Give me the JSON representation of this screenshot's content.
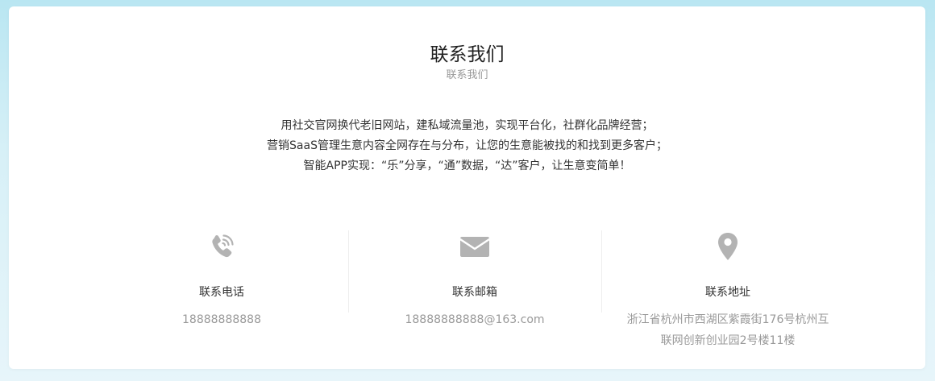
{
  "section": {
    "title": "联系我们",
    "subtitle": "联系我们"
  },
  "intro": {
    "lines": [
      "用社交官网换代老旧网站，建私域流量池，实现平台化，社群化品牌经营；",
      "营销SaaS管理生意内容全网存在与分布，让您的生意能被找的和找到更多客户；",
      "智能APP实现：“乐”分享，“通”数据，“达”客户，让生意变简单！"
    ]
  },
  "contacts": [
    {
      "icon": "phone-icon",
      "label": "联系电话",
      "value": "18888888888"
    },
    {
      "icon": "mail-icon",
      "label": "联系邮箱",
      "value": "18888888888@163.com"
    },
    {
      "icon": "location-pin-icon",
      "label": "联系地址",
      "value": "浙江省杭州市西湖区紫霞街176号杭州互联网创新创业园2号楼11楼"
    }
  ],
  "colors": {
    "icon": "#b3b3b3",
    "muted_text": "#999999",
    "body_text": "#333333"
  }
}
